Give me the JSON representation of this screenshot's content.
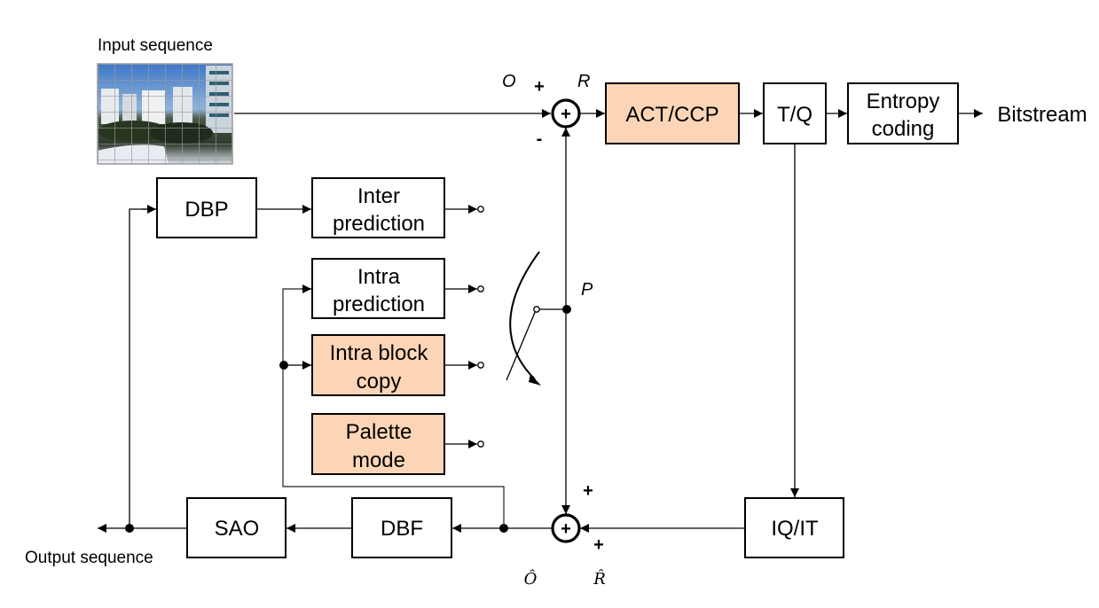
{
  "labels": {
    "input_sequence": "Input sequence",
    "output_sequence": "Output sequence",
    "bitstream": "Bitstream"
  },
  "signals": {
    "original": "O",
    "residual": "R",
    "prediction": "P",
    "recon_original": "Ô",
    "recon_residual": "R̂"
  },
  "signs": {
    "top_plus": "+",
    "top_minus": "-",
    "bottom_plus_top": "+",
    "bottom_plus_right": "+",
    "adder_symbol": "+"
  },
  "blocks": {
    "act_ccp": {
      "line1": "ACT/CCP",
      "highlighted": true
    },
    "tq": {
      "line1": "T/Q",
      "highlighted": false
    },
    "entropy": {
      "line1": "Entropy",
      "line2": "coding",
      "highlighted": false
    },
    "dbp": {
      "line1": "DBP",
      "highlighted": false
    },
    "inter": {
      "line1": "Inter",
      "line2": "prediction",
      "highlighted": false
    },
    "intra": {
      "line1": "Intra",
      "line2": "prediction",
      "highlighted": false
    },
    "ibc": {
      "line1": "Intra block",
      "line2": "copy",
      "highlighted": true
    },
    "palette": {
      "line1": "Palette",
      "line2": "mode",
      "highlighted": true
    },
    "iqit": {
      "line1": "IQ/IT",
      "highlighted": false
    },
    "dbf": {
      "line1": "DBF",
      "highlighted": false
    },
    "sao": {
      "line1": "SAO",
      "highlighted": false
    }
  },
  "colors": {
    "highlight": "#fbd5b5",
    "stroke": "#000000"
  }
}
